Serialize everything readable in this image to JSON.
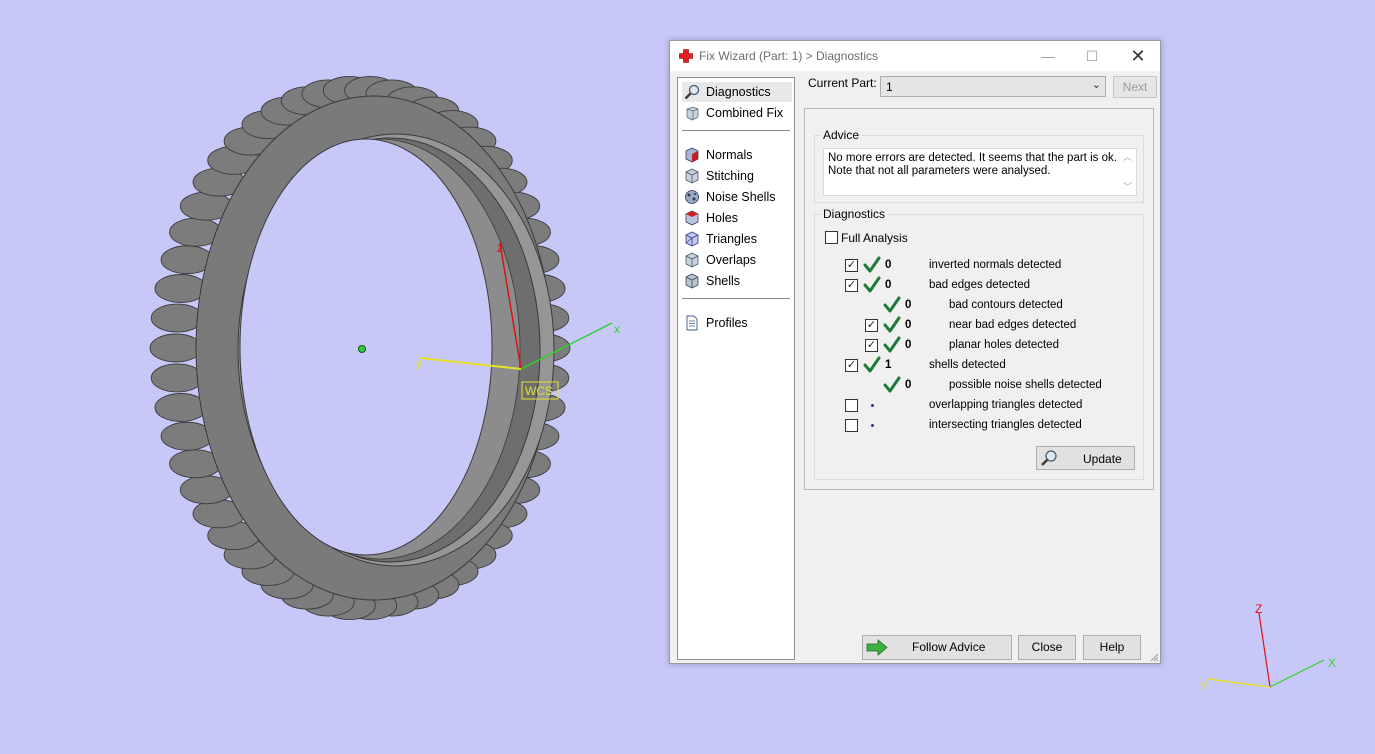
{
  "dialog": {
    "title": "Fix Wizard (Part: 1) > Diagnostics",
    "buttons": {
      "minimize": "—",
      "maximize": "☐",
      "close": "✕"
    }
  },
  "sidebar": {
    "top_items": [
      {
        "label": "Diagnostics",
        "icon": "magnifier-icon",
        "selected": true
      },
      {
        "label": "Combined Fix",
        "icon": "cube-icon"
      }
    ],
    "fix_items": [
      {
        "label": "Normals",
        "icon": "normals-cube-icon"
      },
      {
        "label": "Stitching",
        "icon": "stitching-cube-icon"
      },
      {
        "label": "Noise Shells",
        "icon": "noise-shells-icon"
      },
      {
        "label": "Holes",
        "icon": "holes-cube-icon"
      },
      {
        "label": "Triangles",
        "icon": "triangles-cube-icon"
      },
      {
        "label": "Overlaps",
        "icon": "overlaps-cube-icon"
      },
      {
        "label": "Shells",
        "icon": "shells-cube-icon"
      }
    ],
    "bottom_items": [
      {
        "label": "Profiles",
        "icon": "document-icon"
      }
    ]
  },
  "current_part": {
    "label": "Current Part:",
    "value": "1",
    "next_label": "Next"
  },
  "advice": {
    "title": "Advice",
    "line1": "No more errors are detected. It seems that the part is ok.",
    "line2": "Note that not all parameters were analysed."
  },
  "diagnostics": {
    "title": "Diagnostics",
    "full_analysis_label": "Full Analysis",
    "full_analysis_checked": false,
    "rows": [
      {
        "checked": true,
        "status": "ok",
        "count": "0",
        "label": "inverted normals detected"
      },
      {
        "checked": true,
        "status": "ok",
        "count": "0",
        "label": "bad edges detected"
      },
      {
        "checked": null,
        "status": "ok",
        "count": "0",
        "label": "bad contours detected",
        "indent": true
      },
      {
        "checked": true,
        "status": "ok",
        "count": "0",
        "label": "near bad edges detected",
        "indent": true
      },
      {
        "checked": true,
        "status": "ok",
        "count": "0",
        "label": "planar holes detected",
        "indent": true
      },
      {
        "checked": true,
        "status": "ok",
        "count": "1",
        "label": "shells detected"
      },
      {
        "checked": null,
        "status": "ok",
        "count": "0",
        "label": "possible noise shells detected",
        "indent": true
      },
      {
        "checked": false,
        "status": "none",
        "count": "",
        "label": "overlapping triangles detected"
      },
      {
        "checked": false,
        "status": "none",
        "count": "",
        "label": "intersecting triangles detected"
      }
    ],
    "update_label": "Update"
  },
  "footer": {
    "follow_advice": "Follow Advice",
    "close": "Close",
    "help": "Help"
  },
  "viewport": {
    "wcs_label": "WCS",
    "axis_x": "x",
    "axis_y": "y",
    "axis_z": "z",
    "corner_x": "X",
    "corner_y": "Y",
    "corner_z": "Z",
    "background": "#c8c8f8"
  }
}
